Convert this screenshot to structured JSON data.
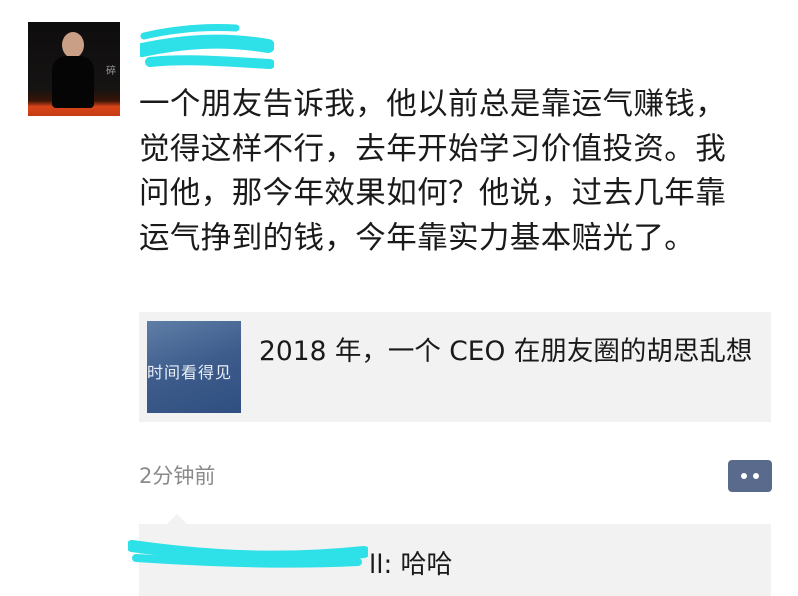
{
  "post": {
    "avatar": {
      "text": "碎"
    },
    "body": "一个朋友告诉我，他以前总是靠运气赚钱，觉得这样不行，去年开始学习价值投资。我问他，那今年效果如何？他说，过去几年靠运气挣到的钱，今年靠实力基本赔光了。",
    "link": {
      "thumb_text": "时间看得见",
      "title": "2018 年，一个 CEO 在朋友圈的胡思乱想"
    },
    "timestamp": "2分钟前"
  },
  "comments": [
    {
      "text": "ll: 哈哈"
    }
  ],
  "colors": {
    "redaction": "#2ee0e8",
    "comment_button": "#5a6a8c",
    "card_background": "#f2f2f2",
    "timestamp": "#8a8a8a"
  },
  "icons": {
    "comment_button": "more-dots-icon"
  }
}
